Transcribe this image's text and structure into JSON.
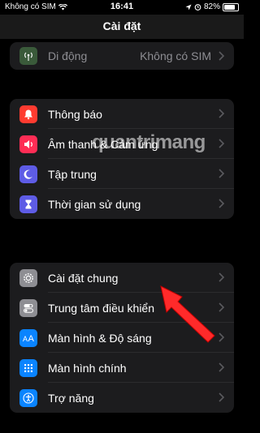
{
  "status": {
    "carrier": "Không có SIM",
    "time": "16:41",
    "battery": "82%",
    "battery_level": 0.82
  },
  "header": {
    "title": "Cài đặt"
  },
  "top_partial": {
    "label": "Di động",
    "value": "Không có SIM"
  },
  "group1": [
    {
      "label": "Thông báo",
      "icon": "bell-icon",
      "color": "#ff3b30"
    },
    {
      "label": "Âm thanh & Cảm ứng",
      "icon": "speaker-icon",
      "color": "#ff2d55"
    },
    {
      "label": "Tập trung",
      "icon": "moon-icon",
      "color": "#5e5ce6"
    },
    {
      "label": "Thời gian sử dụng",
      "icon": "hourglass-icon",
      "color": "#5e5ce6"
    }
  ],
  "group2": [
    {
      "label": "Cài đặt chung",
      "icon": "gear-icon",
      "color": "#8e8e93"
    },
    {
      "label": "Trung tâm điều khiển",
      "icon": "toggles-icon",
      "color": "#8e8e93"
    },
    {
      "label": "Màn hình & Độ sáng",
      "icon": "text-size-icon",
      "color": "#0a84ff"
    },
    {
      "label": "Màn hình chính",
      "icon": "home-grid-icon",
      "color": "#0a84ff"
    },
    {
      "label": "Trợ năng",
      "icon": "accessibility-icon",
      "color": "#0a84ff"
    }
  ],
  "watermark": "quantrimang"
}
